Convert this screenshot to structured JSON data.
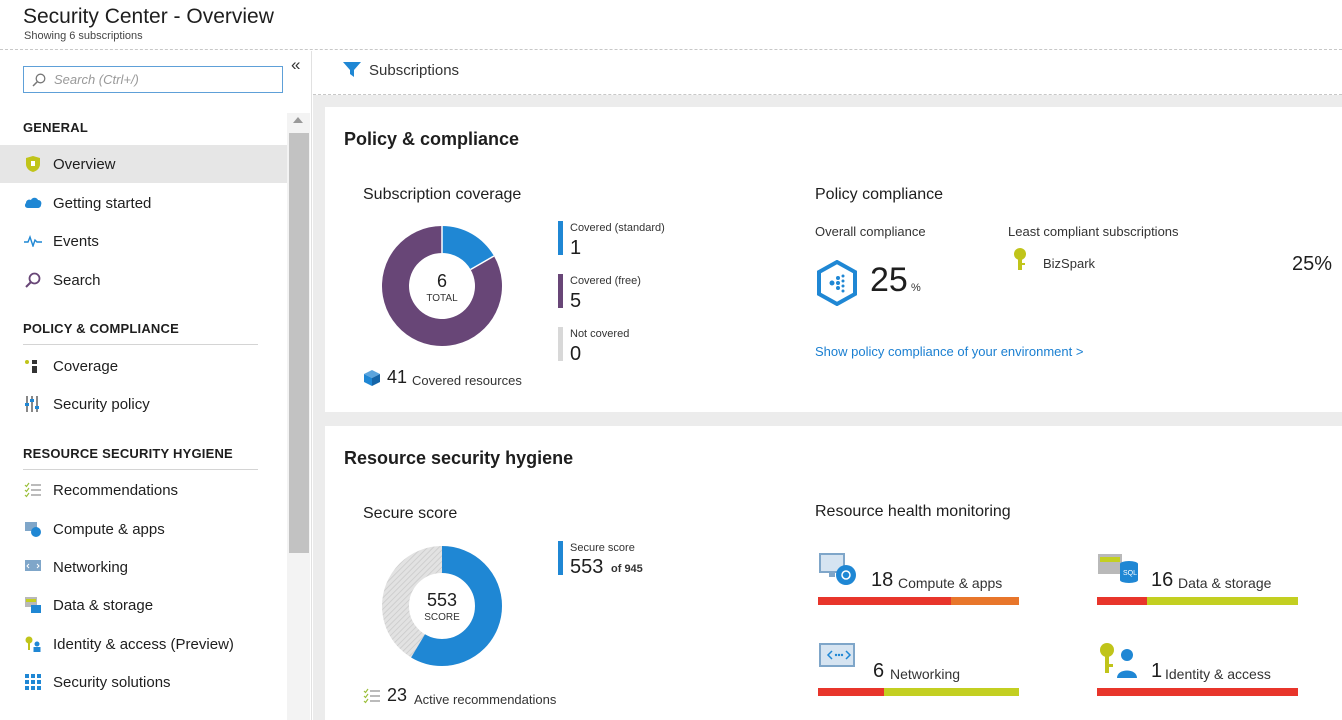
{
  "header": {
    "title": "Security Center - Overview",
    "subtitle": "Showing 6 subscriptions"
  },
  "sidebar": {
    "search_placeholder": "Search (Ctrl+/)",
    "sections": {
      "general": "GENERAL",
      "policy": "POLICY & COMPLIANCE",
      "hygiene": "RESOURCE SECURITY HYGIENE"
    },
    "items": [
      {
        "label": "Overview",
        "icon": "shield-icon"
      },
      {
        "label": "Getting started",
        "icon": "cloud-icon"
      },
      {
        "label": "Events",
        "icon": "pulse-icon"
      },
      {
        "label": "Search",
        "icon": "search-icon"
      },
      {
        "label": "Coverage",
        "icon": "lighthouse-icon"
      },
      {
        "label": "Security policy",
        "icon": "policy-icon"
      },
      {
        "label": "Recommendations",
        "icon": "checklist-icon"
      },
      {
        "label": "Compute & apps",
        "icon": "compute-icon"
      },
      {
        "label": "Networking",
        "icon": "network-icon"
      },
      {
        "label": "Data & storage",
        "icon": "data-icon"
      },
      {
        "label": "Identity & access (Preview)",
        "icon": "identity-icon"
      },
      {
        "label": "Security solutions",
        "icon": "grid-icon"
      }
    ]
  },
  "toolbar": {
    "subscriptions_label": "Subscriptions"
  },
  "policy_card": {
    "title": "Policy & compliance",
    "coverage": {
      "title": "Subscription coverage",
      "total": "6",
      "total_label": "TOTAL",
      "legend": [
        {
          "label": "Covered (standard)",
          "value": "1",
          "color": "#1f87d4"
        },
        {
          "label": "Covered (free)",
          "value": "5",
          "color": "#684677"
        },
        {
          "label": "Not covered",
          "value": "0",
          "color": "#d8d8d8"
        }
      ],
      "covered_resources_num": "41",
      "covered_resources_label": "Covered resources"
    },
    "compliance": {
      "title": "Policy compliance",
      "overall_label": "Overall compliance",
      "overall_value": "25",
      "overall_unit": "%",
      "least_label": "Least compliant subscriptions",
      "subscription_name": "BizSpark",
      "subscription_value": "25%",
      "link": "Show policy compliance of your environment >"
    }
  },
  "hygiene_card": {
    "title": "Resource security hygiene",
    "secure_score": {
      "title": "Secure score",
      "score": "553",
      "score_label": "SCORE",
      "legend_label": "Secure score",
      "legend_value": "553",
      "legend_of": "of 945",
      "score_value": 553,
      "score_max": 945,
      "active_num": "23",
      "active_label": "Active recommendations"
    },
    "health": {
      "title": "Resource health monitoring",
      "items": [
        {
          "count": "18",
          "label": "Compute & apps",
          "segments": [
            {
              "color": "#e8352b",
              "frac": 0.66
            },
            {
              "color": "#e8762b",
              "frac": 0.34
            }
          ]
        },
        {
          "count": "16",
          "label": "Data & storage",
          "segments": [
            {
              "color": "#e8352b",
              "frac": 0.25
            },
            {
              "color": "#c3cf21",
              "frac": 0.75
            }
          ]
        },
        {
          "count": "6",
          "label": "Networking",
          "segments": [
            {
              "color": "#e8352b",
              "frac": 0.33
            },
            {
              "color": "#c3cf21",
              "frac": 0.67
            }
          ]
        },
        {
          "count": "1",
          "label": "Identity & access",
          "segments": [
            {
              "color": "#e8352b",
              "frac": 1.0
            }
          ]
        }
      ]
    }
  }
}
